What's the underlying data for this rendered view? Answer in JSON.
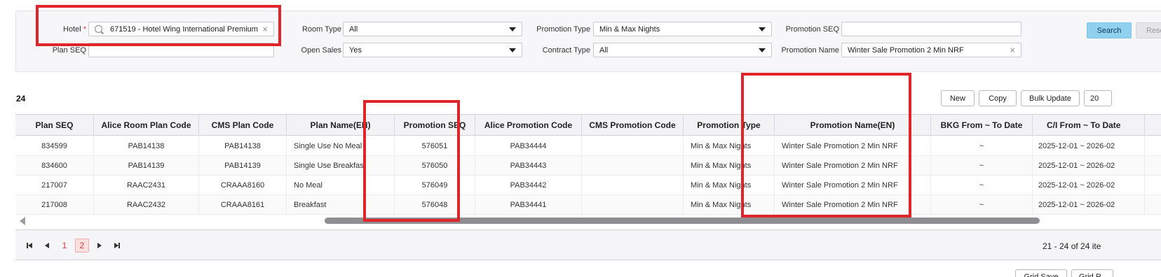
{
  "filters": {
    "hotel": {
      "label": "Hotel",
      "required_mark": "*",
      "value": "671519 - Hotel Wing International Premium",
      "clear": "×"
    },
    "plan_seq": {
      "label": "Plan SEQ",
      "value": ""
    },
    "room_type": {
      "label": "Room Type",
      "value": "All"
    },
    "open_sales": {
      "label": "Open Sales",
      "value": "Yes"
    },
    "promotion_type": {
      "label": "Promotion Type",
      "value": "Min & Max Nights"
    },
    "contract_type": {
      "label": "Contract Type",
      "value": "All"
    },
    "promotion_seq": {
      "label": "Promotion SEQ",
      "value": ""
    },
    "promotion_name": {
      "label": "Promotion Name",
      "value": "Winter Sale Promotion 2 Min NRF",
      "clear": "×"
    },
    "search_button": "Search",
    "reset_button": "Rese"
  },
  "toolbar": {
    "count": "24",
    "new_button": "New",
    "copy_button": "Copy",
    "bulk_update_button": "Bulk Update",
    "extra_button": "20"
  },
  "grid": {
    "columns": [
      "Plan SEQ",
      "Alice Room Plan Code",
      "CMS Plan Code",
      "Plan Name(EN)",
      "Promotion SEQ",
      "Alice Promotion Code",
      "CMS Promotion Code",
      "Promotion Type",
      "Promotion Name(EN)",
      "BKG From ~ To Date",
      "C/I From ~ To Date"
    ],
    "rows": [
      [
        "834599",
        "PAB14138",
        "PAB14138",
        "Single Use No Meal",
        "576051",
        "PAB34444",
        "",
        "Min & Max Nights",
        "Winter Sale Promotion 2 Min NRF",
        "~",
        "2025-12-01 ~ 2026-02"
      ],
      [
        "834600",
        "PAB14139",
        "PAB14139",
        "Single Use Breakfast",
        "576050",
        "PAB34443",
        "",
        "Min & Max Nights",
        "Winter Sale Promotion 2 Min NRF",
        "~",
        "2025-12-01 ~ 2026-02"
      ],
      [
        "217007",
        "RAAC2431",
        "CRAAA8160",
        "No Meal",
        "576049",
        "PAB34442",
        "",
        "Min & Max Nights",
        "Winter Sale Promotion 2 Min NRF",
        "~",
        "2025-12-01 ~ 2026-02"
      ],
      [
        "217008",
        "RAAC2432",
        "CRAAA8161",
        "Breakfast",
        "576048",
        "PAB34441",
        "",
        "Min & Max Nights",
        "Winter Sale Promotion 2 Min NRF",
        "~",
        "2025-12-01 ~ 2026-02"
      ]
    ]
  },
  "pager": {
    "pages": [
      "1",
      "2"
    ],
    "current_page": "2",
    "info": "21 - 24 of 24 ite"
  },
  "footer": {
    "grid_save_button": "Grid Save",
    "grid_reset_button": "Grid R"
  },
  "colors": {
    "highlight": "#e0252a",
    "search_button": "#8fd1ef",
    "required": "#e0313b"
  }
}
